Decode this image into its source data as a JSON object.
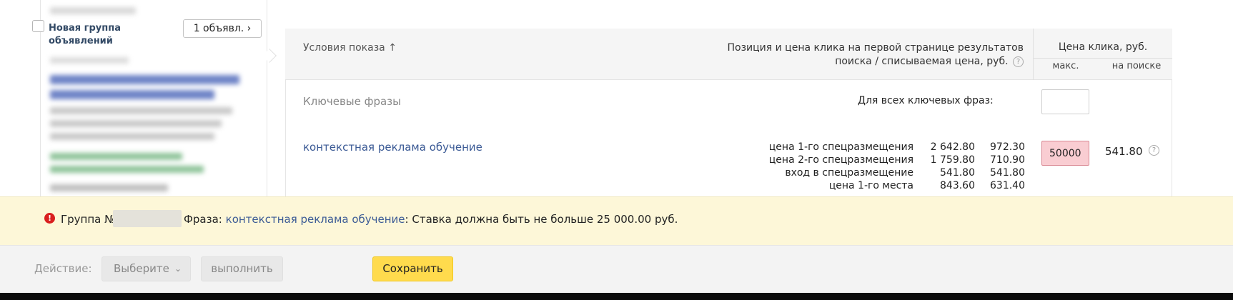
{
  "group": {
    "title": "Новая группа объявлений",
    "ads_button": "1 объявл. ›"
  },
  "table": {
    "header": {
      "conditions": "Условия показа ↑",
      "position_price": "Позиция и цена клика на первой странице результатов поиска / списываемая цена, руб.",
      "click_price": "Цена клика, руб.",
      "max": "макс.",
      "on_search": "на поиске"
    },
    "keywords_label": "Ключевые фразы",
    "all_keywords_label": "Для всех ключевых фраз:",
    "keyword": {
      "phrase": "контекстная реклама обучение",
      "position_labels": [
        "цена 1-го спецразмещения",
        "цена 2-го спецразмещения",
        "вход в спецразмещение",
        "цена 1-го места"
      ],
      "bids": [
        "2 642.80",
        "1 759.80",
        "541.80",
        "843.60"
      ],
      "charged": [
        "972.30",
        "710.90",
        "541.80",
        "631.40"
      ],
      "max_bid_value": "50000",
      "search_price": "541.80"
    }
  },
  "warning": {
    "group_prefix": "Группа №",
    "phrase_label": "Фраза:",
    "phrase": "контекстная реклама обучение",
    "message": ": Ставка должна быть не больше 25 000.00 руб."
  },
  "actions": {
    "label": "Действие:",
    "select_placeholder": "Выберите",
    "execute": "выполнить",
    "save": "Сохранить"
  },
  "colors": {
    "link": "#3b5a95",
    "warning_bg": "#fdf7d8",
    "error_input": "#f9cdd2",
    "save_button": "#ffdb4d"
  },
  "icons": [
    "help-icon",
    "error-icon",
    "chevron-down-icon"
  ]
}
